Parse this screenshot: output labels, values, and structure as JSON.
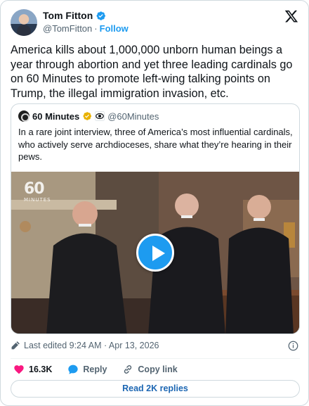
{
  "author": {
    "name": "Tom Fitton",
    "handle": "@TomFitton",
    "separator": "·",
    "follow_label": "Follow"
  },
  "tweet": {
    "text": "America kills about 1,000,000 unborn human beings a year through abortion and yet three leading cardinals go on 60 Minutes to promote left-wing talking points on Trump, the illegal immigration invasion, etc."
  },
  "quoted": {
    "name": "60 Minutes",
    "handle": "@60Minutes",
    "text": "In a rare joint interview, three of America’s most influential cardinals, who actively serve archdioceses, share what they’re hearing in their pews.",
    "watermark_number": "60",
    "watermark_text": "MINUTES"
  },
  "meta": {
    "edited_label": "Last edited 9:24 AM · Apr 13, 2026"
  },
  "actions": {
    "likes": "16.3K",
    "reply_label": "Reply",
    "copy_label": "Copy link"
  },
  "read_replies_label": "Read 2K replies",
  "colors": {
    "accent": "#1d9bf0",
    "like": "#f91880",
    "verified_gold": "#e8b100",
    "text_secondary": "#536471"
  },
  "icons": [
    "verified-icon",
    "x-logo-icon",
    "play-icon",
    "pencil-icon",
    "info-icon",
    "heart-icon",
    "reply-icon",
    "link-icon"
  ]
}
